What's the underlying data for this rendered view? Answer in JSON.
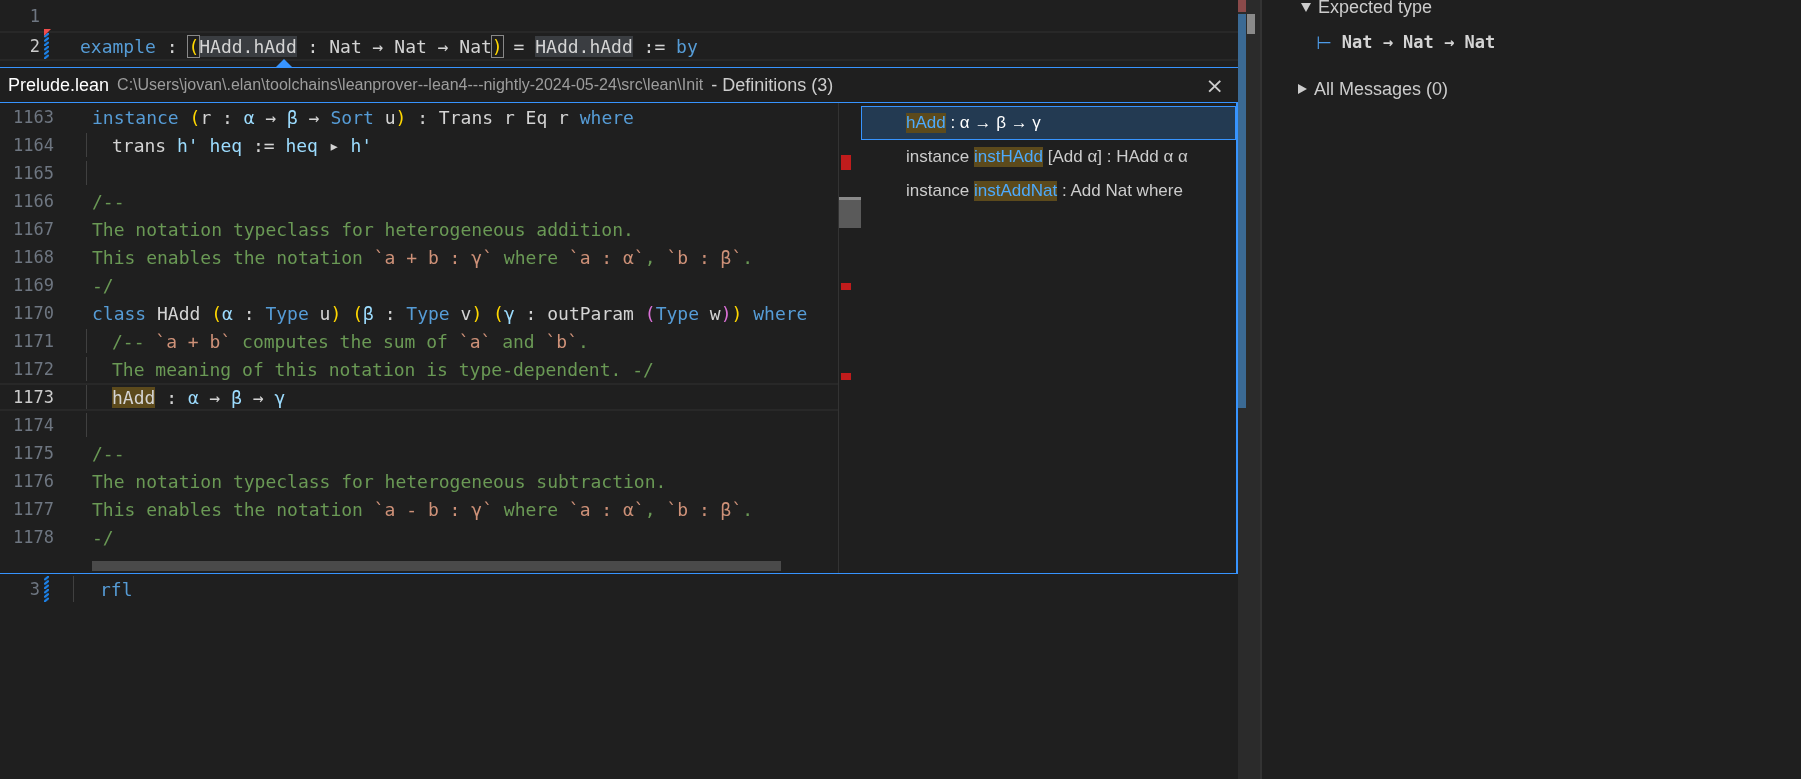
{
  "editor": {
    "top_lines": [
      {
        "number": "1"
      },
      {
        "number": "2",
        "current": true,
        "modified": true,
        "deleted_above": true,
        "tokens": [
          {
            "t": "example",
            "kind": "kw"
          },
          {
            "t": " : ",
            "kind": "plain"
          },
          {
            "t": "(",
            "kind": "p1m"
          },
          {
            "t": "HAdd.hAdd",
            "kind": "occ"
          },
          {
            "t": " : Nat → Nat → Nat",
            "kind": "plain"
          },
          {
            "t": ")",
            "kind": "p1m"
          },
          {
            "t": " = ",
            "kind": "plain"
          },
          {
            "t": "HAdd.hAdd",
            "kind": "occ"
          },
          {
            "t": " := ",
            "kind": "plain"
          },
          {
            "t": "by",
            "kind": "kw"
          }
        ]
      }
    ],
    "peek": {
      "file": "Prelude.lean",
      "path": "C:\\Users\\jovan\\.elan\\toolchains\\leanprover--lean4---nightly-2024-05-24\\src\\lean\\Init",
      "title": "- Definitions (3)",
      "close": "×",
      "lines": [
        {
          "number": "1163",
          "tokens": [
            {
              "t": "instance ",
              "kind": "kw"
            },
            {
              "t": "(",
              "kind": "p1"
            },
            {
              "t": "r : ",
              "kind": "plain"
            },
            {
              "t": "α",
              "kind": "id"
            },
            {
              "t": " → ",
              "kind": "plain"
            },
            {
              "t": "β",
              "kind": "id"
            },
            {
              "t": " → ",
              "kind": "plain"
            },
            {
              "t": "Sort",
              "kind": "kw"
            },
            {
              "t": " u",
              "kind": "plain"
            },
            {
              "t": ")",
              "kind": "p1"
            },
            {
              "t": " : Trans r Eq r ",
              "kind": "plain"
            },
            {
              "t": "where",
              "kind": "kw"
            }
          ]
        },
        {
          "number": "1164",
          "indented": true,
          "tokens": [
            {
              "t": "trans ",
              "kind": "plain"
            },
            {
              "t": "h' heq",
              "kind": "id"
            },
            {
              "t": " := ",
              "kind": "plain"
            },
            {
              "t": "heq",
              "kind": "id"
            },
            {
              "t": " ▸ ",
              "kind": "plain"
            },
            {
              "t": "h'",
              "kind": "id"
            }
          ]
        },
        {
          "number": "1165",
          "indented": true
        },
        {
          "number": "1166",
          "tokens": [
            {
              "t": "/--",
              "kind": "cmt"
            }
          ]
        },
        {
          "number": "1167",
          "tokens": [
            {
              "t": "The notation typeclass for heterogeneous addition.",
              "kind": "cmt"
            }
          ]
        },
        {
          "number": "1168",
          "tokens": [
            {
              "t": "This enables the notation ",
              "kind": "cmt"
            },
            {
              "t": "`a + b : γ`",
              "kind": "str"
            },
            {
              "t": " where ",
              "kind": "cmt"
            },
            {
              "t": "`a : α`",
              "kind": "str"
            },
            {
              "t": ", ",
              "kind": "cmt"
            },
            {
              "t": "`b : β`",
              "kind": "str"
            },
            {
              "t": ".",
              "kind": "cmt"
            }
          ]
        },
        {
          "number": "1169",
          "tokens": [
            {
              "t": "-/",
              "kind": "cmt"
            }
          ]
        },
        {
          "number": "1170",
          "tokens": [
            {
              "t": "class",
              "kind": "kw"
            },
            {
              "t": " HAdd ",
              "kind": "plain"
            },
            {
              "t": "(",
              "kind": "p1"
            },
            {
              "t": "α",
              "kind": "id"
            },
            {
              "t": " : ",
              "kind": "plain"
            },
            {
              "t": "Type",
              "kind": "kw"
            },
            {
              "t": " u",
              "kind": "plain"
            },
            {
              "t": ") (",
              "kind": "p1"
            },
            {
              "t": "β",
              "kind": "id"
            },
            {
              "t": " : ",
              "kind": "plain"
            },
            {
              "t": "Type",
              "kind": "kw"
            },
            {
              "t": " v",
              "kind": "plain"
            },
            {
              "t": ") (",
              "kind": "p1"
            },
            {
              "t": "γ",
              "kind": "id"
            },
            {
              "t": " : outParam ",
              "kind": "plain"
            },
            {
              "t": "(",
              "kind": "p2"
            },
            {
              "t": "Type",
              "kind": "kw"
            },
            {
              "t": " w",
              "kind": "plain"
            },
            {
              "t": ")",
              "kind": "p2"
            },
            {
              "t": ")",
              "kind": "p1"
            },
            {
              "t": " where",
              "kind": "kw"
            }
          ]
        },
        {
          "number": "1171",
          "indented": true,
          "tokens": [
            {
              "t": "/-- ",
              "kind": "cmt"
            },
            {
              "t": "`a + b`",
              "kind": "str"
            },
            {
              "t": " computes the sum of ",
              "kind": "cmt"
            },
            {
              "t": "`a`",
              "kind": "str"
            },
            {
              "t": " and ",
              "kind": "cmt"
            },
            {
              "t": "`b`",
              "kind": "str"
            },
            {
              "t": ".",
              "kind": "cmt"
            }
          ]
        },
        {
          "number": "1172",
          "indented": true,
          "tokens": [
            {
              "t": "The meaning of this notation is type-dependent. -/",
              "kind": "cmt"
            }
          ]
        },
        {
          "number": "1173",
          "current": true,
          "indented": true,
          "tokens": [
            {
              "t": "hAdd",
              "kind": "def"
            },
            {
              "t": " : ",
              "kind": "plain"
            },
            {
              "t": "α",
              "kind": "id"
            },
            {
              "t": " → ",
              "kind": "plain"
            },
            {
              "t": "β",
              "kind": "id"
            },
            {
              "t": " → ",
              "kind": "plain"
            },
            {
              "t": "γ",
              "kind": "id"
            }
          ]
        },
        {
          "number": "1174",
          "indented": true
        },
        {
          "number": "1175",
          "tokens": [
            {
              "t": "/--",
              "kind": "cmt"
            }
          ]
        },
        {
          "number": "1176",
          "tokens": [
            {
              "t": "The notation typeclass for heterogeneous subtraction.",
              "kind": "cmt"
            }
          ]
        },
        {
          "number": "1177",
          "tokens": [
            {
              "t": "This enables the notation ",
              "kind": "cmt"
            },
            {
              "t": "`a - b : γ`",
              "kind": "str"
            },
            {
              "t": " where ",
              "kind": "cmt"
            },
            {
              "t": "`a : α`",
              "kind": "str"
            },
            {
              "t": ", ",
              "kind": "cmt"
            },
            {
              "t": "`b : β`",
              "kind": "str"
            },
            {
              "t": ".",
              "kind": "cmt"
            }
          ]
        },
        {
          "number": "1178",
          "tokens": [
            {
              "t": "-/",
              "kind": "cmt"
            }
          ]
        }
      ],
      "references": [
        {
          "selected": true,
          "parts": [
            {
              "t": "hAdd",
              "kind": "def"
            },
            {
              "t": " : α → β → γ",
              "kind": "plain"
            }
          ]
        },
        {
          "selected": false,
          "parts": [
            {
              "t": "instance ",
              "kind": "plain"
            },
            {
              "t": "instHAdd",
              "kind": "def"
            },
            {
              "t": " [Add α] : HAdd α α",
              "kind": "plain"
            }
          ]
        },
        {
          "selected": false,
          "parts": [
            {
              "t": "instance ",
              "kind": "plain"
            },
            {
              "t": "instAddNat",
              "kind": "def"
            },
            {
              "t": " : Add Nat where",
              "kind": "plain"
            }
          ]
        }
      ]
    },
    "bottom_lines": [
      {
        "number": "3",
        "modified": true,
        "indented": true,
        "tokens": [
          {
            "t": "rfl",
            "kind": "kw"
          }
        ]
      }
    ]
  },
  "infoview": {
    "sections": [
      {
        "title": "Expected type",
        "expanded": true,
        "goal": {
          "turnstile": "⊢",
          "type": "Nat → Nat → Nat"
        }
      },
      {
        "title": "All Messages (0)",
        "expanded": false
      }
    ]
  }
}
